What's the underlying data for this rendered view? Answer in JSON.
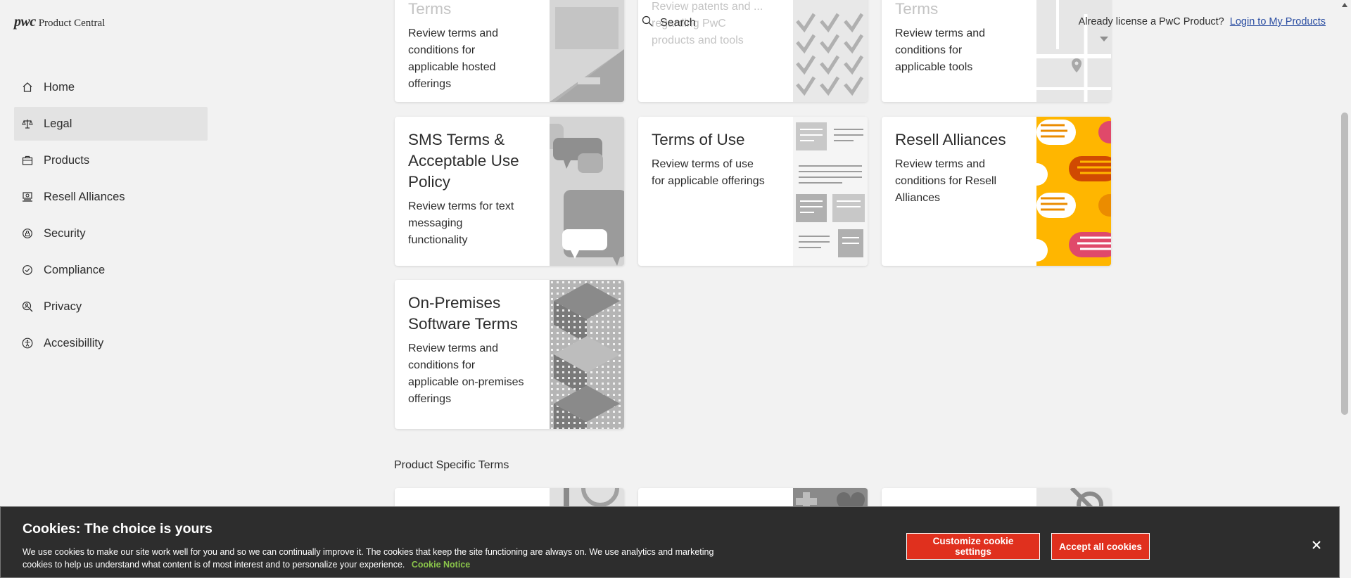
{
  "header": {
    "logo": "pwc",
    "product_name": "Product Central",
    "search_label": "Search",
    "license_question": "Already license a PwC Product?",
    "login_link": "Login to My Products"
  },
  "sidebar": {
    "items": [
      {
        "label": "Home",
        "icon": "home-icon",
        "active": false
      },
      {
        "label": "Legal",
        "icon": "scales-icon",
        "active": true
      },
      {
        "label": "Products",
        "icon": "briefcase-icon",
        "active": false
      },
      {
        "label": "Resell Alliances",
        "icon": "handshake-icon",
        "active": false
      },
      {
        "label": "Security",
        "icon": "shield-icon",
        "active": false
      },
      {
        "label": "Compliance",
        "icon": "check-circle-icon",
        "active": false
      },
      {
        "label": "Privacy",
        "icon": "person-search-icon",
        "active": false
      },
      {
        "label": "Accesibillity",
        "icon": "accessibility-icon",
        "active": false
      }
    ]
  },
  "top_cards": [
    {
      "title": "Terms",
      "desc": "Review terms and conditions for applicable hosted offerings"
    },
    {
      "title": "",
      "desc": "Review patents and ... regarding PwC products and tools"
    },
    {
      "title": "Terms",
      "desc": "Review terms and conditions for applicable tools"
    }
  ],
  "cards": [
    {
      "title": "SMS Terms & Acceptable Use Policy",
      "desc": "Review terms for text messaging functionality",
      "art": "speech-bubbles"
    },
    {
      "title": "Terms of Use",
      "desc": "Review terms of use for applicable offerings",
      "art": "document-lines"
    },
    {
      "title": "Resell Alliances",
      "desc": "Review terms and conditions for Resell Alliances",
      "art": "orange-hands"
    },
    {
      "title": "On-Premises Software Terms",
      "desc": "Review terms and conditions for applicable on-premises offerings",
      "art": "buildings"
    }
  ],
  "section": {
    "product_specific": "Product Specific Terms"
  },
  "cookie": {
    "title": "Cookies: The choice is yours",
    "text": "We use cookies to make our site work well for you and so we can continually improve it. The cookies that keep the site functioning are always on. We use analytics and marketing cookies to help us understand what content is of most interest and to personalize your experience.",
    "link": "Cookie Notice",
    "customize": "Customize cookie settings",
    "accept": "Accept all cookies"
  },
  "colors": {
    "accent": "#e0301e",
    "link": "#2b4ea2",
    "resell_orange": "#ffb600",
    "cookie_green": "#8ac54a"
  }
}
